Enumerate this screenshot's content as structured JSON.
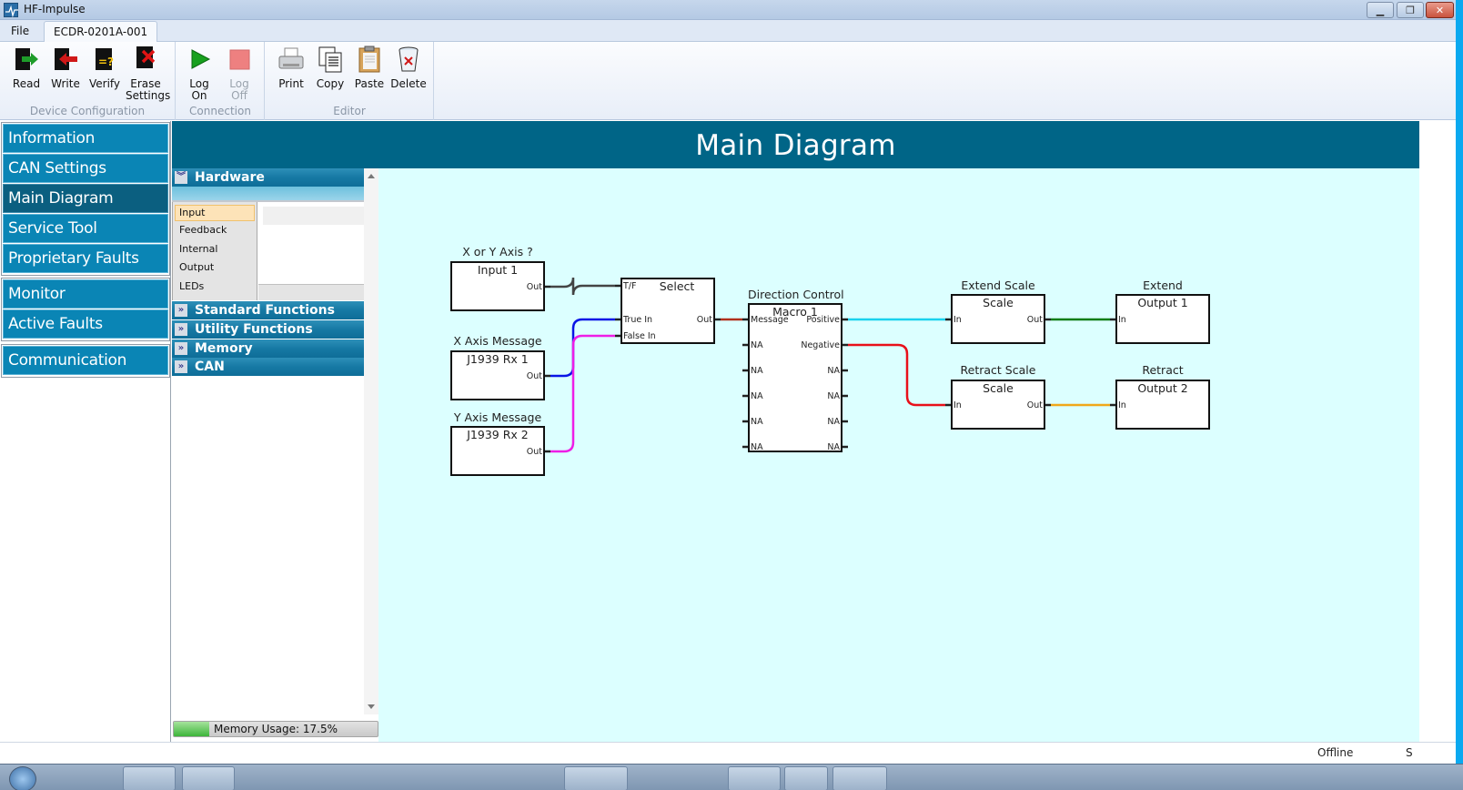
{
  "window": {
    "title": "HF-Impulse",
    "controls": {
      "minimize": "minimize",
      "maximize": "restore",
      "close": "close"
    }
  },
  "menu": {
    "file_label": "File",
    "device_tab_label": "ECDR-0201A-001"
  },
  "ribbon": {
    "groups": [
      {
        "label": "Device Configuration",
        "buttons": [
          {
            "label": "Read",
            "icon": "read-icon",
            "enabled": true
          },
          {
            "label": "Write",
            "icon": "write-icon",
            "enabled": true
          },
          {
            "label": "Verify",
            "icon": "verify-icon",
            "enabled": true
          },
          {
            "label": "Erase Settings",
            "icon": "erase-icon",
            "enabled": true
          }
        ]
      },
      {
        "label": "Connection",
        "buttons": [
          {
            "label": "Log On",
            "icon": "play-icon",
            "enabled": true
          },
          {
            "label": "Log Off",
            "icon": "stop-icon",
            "enabled": false
          }
        ]
      },
      {
        "label": "Editor",
        "buttons": [
          {
            "label": "Print",
            "icon": "printer-icon",
            "enabled": true
          },
          {
            "label": "Copy",
            "icon": "copy-icon",
            "enabled": true
          },
          {
            "label": "Paste",
            "icon": "paste-icon",
            "enabled": true
          },
          {
            "label": "Delete",
            "icon": "trash-icon",
            "enabled": true
          }
        ]
      }
    ]
  },
  "nav": {
    "groups": [
      {
        "items": [
          {
            "label": "Information",
            "active": false
          },
          {
            "label": "CAN Settings",
            "active": false
          },
          {
            "label": "Main Diagram",
            "active": true
          },
          {
            "label": "Service Tool",
            "active": false
          },
          {
            "label": "Proprietary Faults",
            "active": false
          }
        ]
      },
      {
        "items": [
          {
            "label": "Monitor",
            "active": false
          },
          {
            "label": "Active Faults",
            "active": false
          }
        ]
      },
      {
        "items": [
          {
            "label": "Communication",
            "active": false
          }
        ]
      }
    ]
  },
  "palette": {
    "sections": [
      {
        "label": "Hardware",
        "expanded": true
      },
      {
        "label": "Standard Functions",
        "expanded": false
      },
      {
        "label": "Utility Functions",
        "expanded": false
      },
      {
        "label": "Memory",
        "expanded": false
      },
      {
        "label": "CAN",
        "expanded": false
      }
    ],
    "hardware_items": [
      {
        "label": "Input",
        "selected": true
      },
      {
        "label": "Feedback",
        "selected": false
      },
      {
        "label": "Internal",
        "selected": false
      },
      {
        "label": "Output",
        "selected": false
      },
      {
        "label": "LEDs",
        "selected": false
      }
    ]
  },
  "memory": {
    "label": "Memory Usage: 17.5%",
    "percent": 17.5
  },
  "diagram": {
    "title": "Main Diagram",
    "blocks": [
      {
        "id": "input1",
        "caption": "X or Y Axis ?",
        "name": "Input 1",
        "inputs": [],
        "outputs": [
          "Out"
        ]
      },
      {
        "id": "rx1",
        "caption": "X Axis Message",
        "name": "J1939 Rx 1",
        "inputs": [],
        "outputs": [
          "Out"
        ]
      },
      {
        "id": "rx2",
        "caption": "Y Axis Message",
        "name": "J1939 Rx 2",
        "inputs": [],
        "outputs": [
          "Out"
        ]
      },
      {
        "id": "select",
        "caption": "",
        "name": "Select",
        "inputs": [
          "T/F",
          "True In",
          "False In"
        ],
        "outputs": [
          "Out"
        ]
      },
      {
        "id": "macro1",
        "caption": "Direction Control",
        "name": "Macro 1",
        "inputs": [
          "Message",
          "NA",
          "NA",
          "NA",
          "NA",
          "NA"
        ],
        "outputs": [
          "Positive",
          "Negative",
          "NA",
          "NA",
          "NA",
          "NA"
        ]
      },
      {
        "id": "scale1",
        "caption": "Extend Scale",
        "name": "Scale",
        "inputs": [
          "In"
        ],
        "outputs": [
          "Out"
        ]
      },
      {
        "id": "scale2",
        "caption": "Retract Scale",
        "name": "Scale",
        "inputs": [
          "In"
        ],
        "outputs": [
          "Out"
        ]
      },
      {
        "id": "out1",
        "caption": "Extend",
        "name": "Output 1",
        "inputs": [
          "In"
        ],
        "outputs": []
      },
      {
        "id": "out2",
        "caption": "Retract",
        "name": "Output 2",
        "inputs": [
          "In"
        ],
        "outputs": []
      }
    ],
    "wires": [
      {
        "from": "input1.Out",
        "to": "select.T/F",
        "color": "#444444"
      },
      {
        "from": "rx1.Out",
        "to": "select.True In",
        "color": "#0a14e6"
      },
      {
        "from": "rx2.Out",
        "to": "select.False In",
        "color": "#ee1ee6"
      },
      {
        "from": "select.Out",
        "to": "macro1.Message",
        "color": "#b0301c"
      },
      {
        "from": "macro1.Positive",
        "to": "scale1.In",
        "color": "#1ad2ee"
      },
      {
        "from": "macro1.Negative",
        "to": "scale2.In",
        "color": "#e8101a"
      },
      {
        "from": "scale1.Out",
        "to": "out1.In",
        "color": "#0f7d14"
      },
      {
        "from": "scale2.Out",
        "to": "out2.In",
        "color": "#f0a81a"
      }
    ]
  },
  "status": {
    "connection": "Offline",
    "extra": "S"
  },
  "colors": {
    "nav_bg": "#0a85b5",
    "nav_active": "#0b5f80",
    "header_bg": "#006587",
    "canvas_bg": "#dcffff"
  }
}
